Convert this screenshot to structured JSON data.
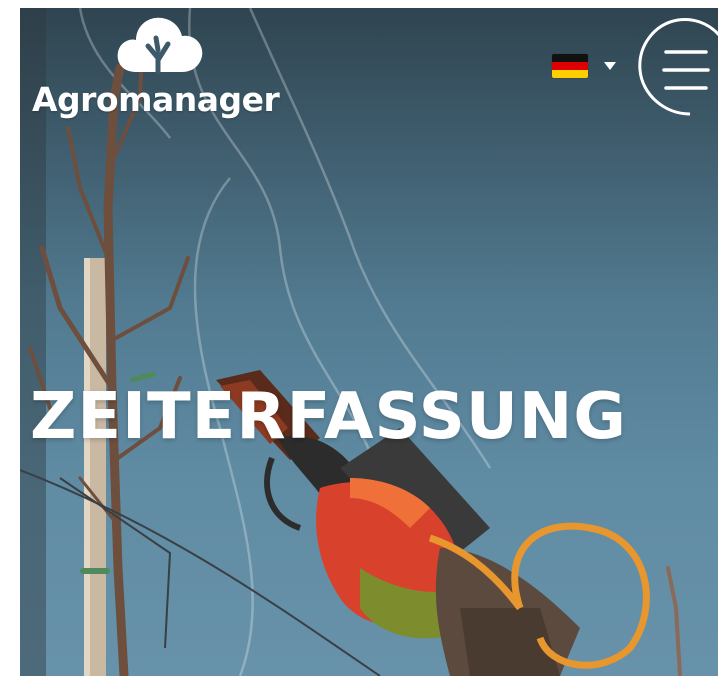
{
  "header": {
    "brand_name": "Agromanager",
    "logo_icon": "cloud-tree-icon",
    "language": {
      "flag_icon": "flag-germany-icon",
      "dropdown_icon": "caret-down-icon"
    },
    "menu_icon": "hamburger-menu-icon"
  },
  "hero": {
    "headline": "ZEITERFASSUNG"
  },
  "colors": {
    "text": "#ffffff",
    "sky": "#5f8ba3",
    "glove_red": "#d8412c",
    "hose_orange": "#e8962e"
  }
}
